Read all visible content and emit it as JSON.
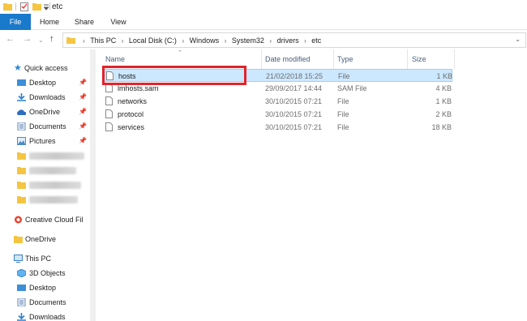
{
  "window": {
    "title": "etc"
  },
  "ribbon": {
    "tabs": [
      {
        "label": "File"
      },
      {
        "label": "Home"
      },
      {
        "label": "Share"
      },
      {
        "label": "View"
      }
    ]
  },
  "address": {
    "crumbs": [
      "This PC",
      "Local Disk (C:)",
      "Windows",
      "System32",
      "drivers",
      "etc"
    ]
  },
  "sidebar": {
    "items": [
      {
        "label": "Quick access",
        "icon": "star-icon"
      },
      {
        "label": "Desktop",
        "icon": "desktop-folder-icon",
        "pinned": true
      },
      {
        "label": "Downloads",
        "icon": "downloads-folder-icon",
        "pinned": true
      },
      {
        "label": "OneDrive",
        "icon": "onedrive-cloud-icon",
        "pinned": true
      },
      {
        "label": "Documents",
        "icon": "documents-folder-icon",
        "pinned": true
      },
      {
        "label": "Pictures",
        "icon": "pictures-folder-icon",
        "pinned": true
      },
      {
        "label": "Creative Cloud Fil",
        "icon": "creative-cloud-icon"
      },
      {
        "label": "OneDrive",
        "icon": "folder-icon"
      },
      {
        "label": "This PC",
        "icon": "computer-icon"
      },
      {
        "label": "3D Objects",
        "icon": "3d-objects-icon"
      },
      {
        "label": "Desktop",
        "icon": "desktop-folder-icon"
      },
      {
        "label": "Documents",
        "icon": "documents-folder-icon"
      },
      {
        "label": "Downloads",
        "icon": "downloads-folder-icon"
      }
    ]
  },
  "columns": {
    "name": "Name",
    "date": "Date modified",
    "type": "Type",
    "size": "Size"
  },
  "files": [
    {
      "name": "hosts",
      "date": "21/02/2018 15:25",
      "type": "File",
      "size": "1 KB",
      "selected": true
    },
    {
      "name": "lmhosts.sam",
      "date": "29/09/2017 14:44",
      "type": "SAM File",
      "size": "4 KB"
    },
    {
      "name": "networks",
      "date": "30/10/2015 07:21",
      "type": "File",
      "size": "1 KB"
    },
    {
      "name": "protocol",
      "date": "30/10/2015 07:21",
      "type": "File",
      "size": "2 KB"
    },
    {
      "name": "services",
      "date": "30/10/2015 07:21",
      "type": "File",
      "size": "18 KB"
    }
  ],
  "colors": {
    "accent": "#1979ca",
    "selection": "#cce8ff",
    "highlight": "#e3232c",
    "folder": "#f5c542"
  }
}
